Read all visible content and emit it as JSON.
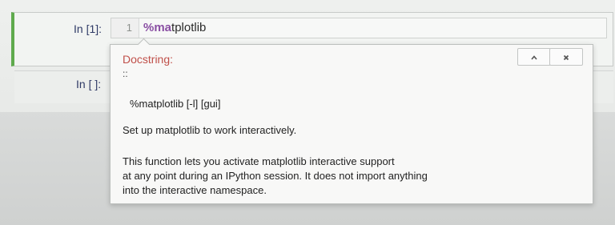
{
  "cells": [
    {
      "prompt": "In [1]:",
      "line_number": "1",
      "code_magic": "%ma",
      "code_rest": "tplotlib"
    },
    {
      "prompt": "In [ ]:"
    }
  ],
  "tooltip": {
    "header": "Docstring:",
    "colons": "::",
    "signature": "%matplotlib [-l] [gui]",
    "summary": "Set up matplotlib to work interactively.",
    "body_lines": [
      "This function lets you activate matplotlib interactive support",
      "at any point during an IPython session. It does not import anything",
      "into the interactive namespace."
    ],
    "buttons": {
      "expand_icon": "chevron-up-icon",
      "close_icon": "close-icon"
    }
  },
  "colors": {
    "active_cell_border": "#5faa4d",
    "prompt": "#2f3a66",
    "magic": "#8a4fa3",
    "doc_header": "#c0504a"
  }
}
